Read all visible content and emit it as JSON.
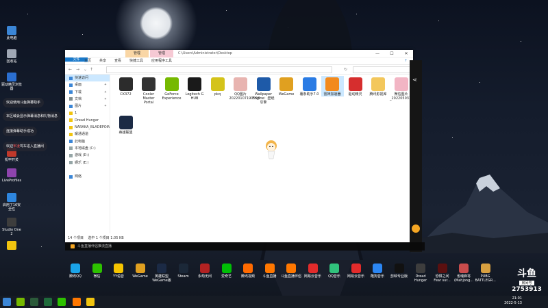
{
  "desktop_icons": [
    {
      "label": "此电脑",
      "color": "#3b86d6"
    },
    {
      "label": "回收站",
      "color": "#a0a8b5"
    },
    {
      "label": "驱动精灵浏览器",
      "color": "#2b6fd1"
    },
    {
      "label": "机甲开关",
      "color": "#c0392b"
    },
    {
      "label": "LiveProfiles",
      "color": "#8e44ad"
    },
    {
      "label": "启用了16安全性",
      "color": "#2e86de"
    },
    {
      "label": "Studio One 2",
      "color": "#3d3d3d"
    },
    {
      "label": "",
      "color": "#f1c40f"
    }
  ],
  "chat_messages": [
    {
      "text": "欢迎使用斗鱼弹幕助手"
    },
    {
      "text": "本区域会显示弹幕消息和礼物消息"
    },
    {
      "text": "连接弹幕助手成功"
    },
    {
      "prefix": "欢迎",
      "highlight": "宋凌",
      "suffix": "驾车进入直播间"
    }
  ],
  "explorer": {
    "ctx_tabs": [
      "管理",
      "管理"
    ],
    "title_path": "C:\\Users\\Administrator\\Desktop",
    "ribbon_tabs": [
      "文件",
      "主页",
      "共享",
      "查看",
      "快捷工具",
      "应用程序工具"
    ],
    "search_placeholder": "",
    "nav_items": [
      {
        "label": "快速访问",
        "color": "#3b86d6",
        "sel": true,
        "pin": false
      },
      {
        "label": "桌面",
        "color": "#3b86d6",
        "sel": false,
        "pin": true
      },
      {
        "label": "下载",
        "color": "#3b86d6",
        "sel": false,
        "pin": true
      },
      {
        "label": "文档",
        "color": "#7f8c8d",
        "sel": false,
        "pin": true
      },
      {
        "label": "图片",
        "color": "#3b86d6",
        "sel": false,
        "pin": true
      },
      {
        "label": "1",
        "color": "#f1c40f",
        "sel": false,
        "pin": false
      },
      {
        "label": "Dread Hunger",
        "color": "#f1c40f",
        "sel": false,
        "pin": false
      },
      {
        "label": "NARAKA_BLADEPOINT",
        "color": "#f1c40f",
        "sel": false,
        "pin": false
      },
      {
        "label": "暖通通道",
        "color": "#f1c40f",
        "sel": false,
        "pin": false
      },
      {
        "label": "此电脑",
        "color": "#3b86d6",
        "sel": false,
        "pin": false
      },
      {
        "label": "本地磁盘 (C:)",
        "color": "#95a5a6",
        "sel": false,
        "pin": false
      },
      {
        "label": "游戏 (D:)",
        "color": "#95a5a6",
        "sel": false,
        "pin": false
      },
      {
        "label": "娱乐 (E:)",
        "color": "#95a5a6",
        "sel": false,
        "pin": false
      },
      {
        "label": "",
        "color": "#ffffff",
        "sel": false,
        "pin": false
      },
      {
        "label": "网络",
        "color": "#3b86d6",
        "sel": false,
        "pin": false
      }
    ],
    "files": [
      {
        "label": "CK372",
        "color": "#2c2c2c",
        "sel": false
      },
      {
        "label": "Cooler Master Portal",
        "color": "#333333",
        "sel": false
      },
      {
        "label": "GeForce Experience",
        "color": "#76b900",
        "sel": false
      },
      {
        "label": "Logitech G HUB",
        "color": "#1a1a1a",
        "sel": false
      },
      {
        "label": "pkq",
        "color": "#d4c31a",
        "sel": false
      },
      {
        "label": "QQ图片20220107190558",
        "color": "#e8b4b0",
        "sel": false
      },
      {
        "label": "Wallpaper Engine：壁纸引擎",
        "color": "#1e5aa8",
        "sel": false
      },
      {
        "label": "WeGame",
        "color": "#e0a020",
        "sel": false
      },
      {
        "label": "薯条助手7.0",
        "color": "#2a7be4",
        "sel": false
      },
      {
        "label": "雷神加速器",
        "color": "#f28a1d",
        "sel": true
      },
      {
        "label": "驱动精灵",
        "color": "#d62e2e",
        "sel": false
      },
      {
        "label": "腾讯影视库",
        "color": "#f3c75c",
        "sel": false
      },
      {
        "label": "微信图片_20220503183634",
        "color": "#f2b5c4",
        "sel": false
      },
      {
        "label": "英雄联盟",
        "color": "#1b2a45",
        "sel": false
      }
    ],
    "status_count": "14 个项目",
    "status_selected": "选中 1 个项目 1.05 KB"
  },
  "stream_bar": {
    "text": "斗鱼直播伴侣推流直播"
  },
  "dock_items": [
    {
      "label": "腾讯QQ",
      "color": "#1aa3e8"
    },
    {
      "label": "微信",
      "color": "#2dc100"
    },
    {
      "label": "YY语音",
      "color": "#f5c400"
    },
    {
      "label": "WeGame",
      "color": "#e0a020"
    },
    {
      "label": "英雄联盟WeGame版",
      "color": "#1b2a45"
    },
    {
      "label": "Steam",
      "color": "#1b2838"
    },
    {
      "label": "永劫无间",
      "color": "#b22222"
    },
    {
      "label": "爱奇艺",
      "color": "#00be06"
    },
    {
      "label": "腾讯视频",
      "color": "#ff6a00"
    },
    {
      "label": "斗鱼直播",
      "color": "#ff7700"
    },
    {
      "label": "斗鱼直播伴侣",
      "color": "#ff7700"
    },
    {
      "label": "网易云音乐",
      "color": "#e22b2b"
    },
    {
      "label": "QQ音乐",
      "color": "#31c27c"
    },
    {
      "label": "网易云音乐",
      "color": "#e22b2b"
    },
    {
      "label": "酷狗音乐",
      "color": "#2b86f3"
    },
    {
      "label": "剪映专业版",
      "color": "#111111"
    },
    {
      "label": "Dread Hunger",
      "color": "#3d3d3d"
    },
    {
      "label": "恐惧之间 Fear sur...",
      "color": "#5a1010"
    },
    {
      "label": "雀魂麻将 (Mahjong...",
      "color": "#c94c4c"
    },
    {
      "label": "PUBG BATTLEGR...",
      "color": "#d8a040"
    }
  ],
  "douyu": {
    "logo": "斗鱼",
    "room_label": "房间号",
    "room_id": "2753913"
  },
  "clock": {
    "time": "21:01",
    "date": "2022-5-13"
  }
}
